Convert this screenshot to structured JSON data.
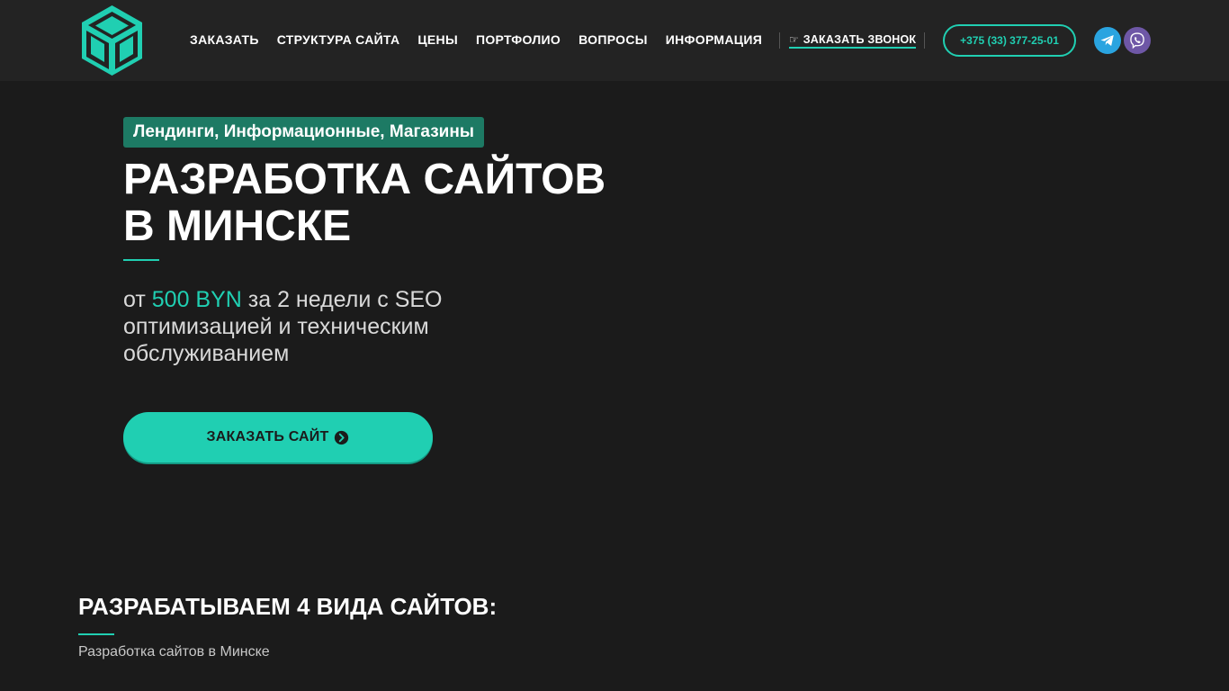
{
  "header": {
    "logo_icon": "cube-logo-icon",
    "nav": [
      {
        "label": "ЗАКАЗАТЬ"
      },
      {
        "label": "СТРУКТУРА САЙТА"
      },
      {
        "label": "ЦЕНЫ"
      },
      {
        "label": "ПОРТФОЛИО"
      },
      {
        "label": "ВОПРОСЫ"
      },
      {
        "label": "ИНФОРМАЦИЯ"
      }
    ],
    "callback": {
      "icon": "☞",
      "label": "ЗАКАЗАТЬ ЗВОНОК"
    },
    "phone": "+375 (33) 377-25-01",
    "social": [
      {
        "icon": "telegram-icon",
        "color": "#2aa4e0"
      },
      {
        "icon": "viber-icon",
        "color": "#6e57a6"
      }
    ]
  },
  "hero": {
    "tagline": "Лендинги, Информационные, Магазины",
    "title_line1": "РАЗРАБОТКА САЙТОВ",
    "title_line2": "В МИНСКЕ",
    "subtitle_prefix": "от ",
    "price": "500 BYN",
    "subtitle_suffix": " за 2 недели с SEO оптимизацией и техническим обслуживанием",
    "cta_label": "ЗАКАЗАТЬ САЙТ"
  },
  "section": {
    "title": "РАЗРАБАТЫВАЕМ 4 ВИДА САЙТОВ:",
    "subtitle": "Разработка сайтов в Минске"
  },
  "colors": {
    "accent": "#20cfb2",
    "background": "#1b1b1b",
    "header_bg": "#232323",
    "tag_bg": "#1d7a64"
  }
}
